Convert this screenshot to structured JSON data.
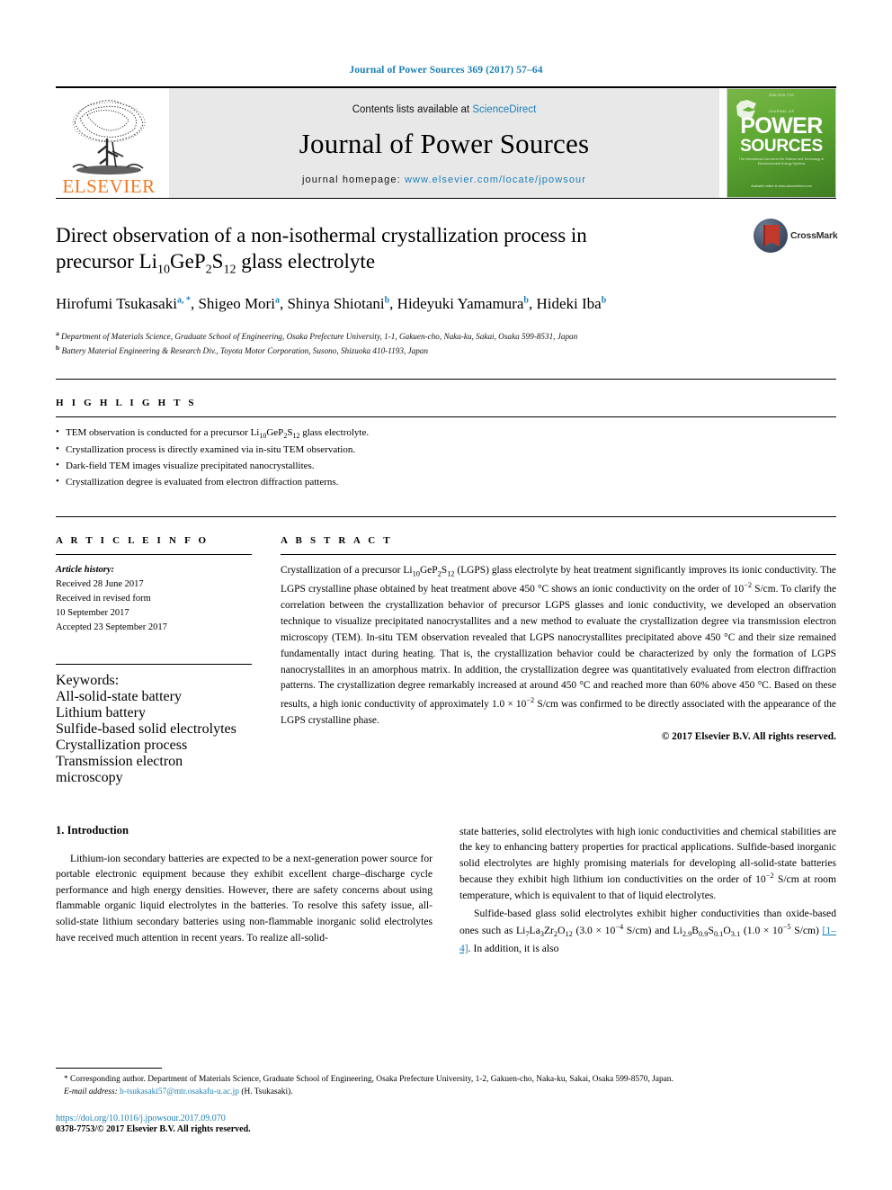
{
  "running_head": "Journal of Power Sources 369 (2017) 57–64",
  "masthead": {
    "publisher_name": "ELSEVIER",
    "contents_prefix": "Contents lists available at ",
    "contents_link": "ScienceDirect",
    "journal_title": "Journal of Power Sources",
    "homepage_prefix": "journal homepage: ",
    "homepage_url": "www.elsevier.com/locate/jpowsour",
    "cover": {
      "top_line": "ISSN 0378-7753",
      "journal_small": "JOURNAL OF",
      "word_power": "POWER",
      "word_sources": "SOURCES",
      "subtitle": "The International Journal on the Science and Technology of Electrochemical Energy Systems",
      "bottom": "Available online at www.sciencedirect.com"
    }
  },
  "article": {
    "title_line1": "Direct observation of a non-isothermal crystallization process in",
    "title_line2_pre": "precursor Li",
    "title_sub1": "10",
    "title_mid1": "GeP",
    "title_sub2": "2",
    "title_mid2": "S",
    "title_sub3": "12",
    "title_end": " glass electrolyte",
    "authors": [
      {
        "name": "Hirofumi Tsukasaki",
        "marks": "a, *"
      },
      {
        "name": "Shigeo Mori",
        "marks": "a"
      },
      {
        "name": "Shinya Shiotani",
        "marks": "b"
      },
      {
        "name": "Hideyuki Yamamura",
        "marks": "b"
      },
      {
        "name": "Hideki Iba",
        "marks": "b"
      }
    ],
    "affiliations": [
      {
        "mark": "a",
        "text": "Department of Materials Science, Graduate School of Engineering, Osaka Prefecture University, 1-1, Gakuen-cho, Naka-ku, Sakai, Osaka 599-8531, Japan"
      },
      {
        "mark": "b",
        "text": "Battery Material Engineering & Research Div., Toyota Motor Corporation, Susono, Shizuoka 410-1193, Japan"
      }
    ],
    "crossmark_label": "CrossMark"
  },
  "highlights": {
    "label": "H I G H L I G H T S",
    "items": [
      "TEM observation is conducted for a precursor Li10GeP2S12 glass electrolyte.",
      "Crystallization process is directly examined via in-situ TEM observation.",
      "Dark-field TEM images visualize precipitated nanocrystallites.",
      "Crystallization degree is evaluated from electron diffraction patterns."
    ]
  },
  "article_info": {
    "label": "A R T I C L E   I N F O",
    "history_label": "Article history:",
    "history": [
      "Received 28 June 2017",
      "Received in revised form",
      "10 September 2017",
      "Accepted 23 September 2017"
    ],
    "keywords_label": "Keywords:",
    "keywords": [
      "All-solid-state battery",
      "Lithium battery",
      "Sulfide-based solid electrolytes",
      "Crystallization process",
      "Transmission electron microscopy"
    ]
  },
  "abstract": {
    "label": "A B S T R A C T",
    "text_part1": "Crystallization of a precursor Li",
    "sub1": "10",
    "text_part2": "GeP",
    "sub2": "2",
    "text_part3": "S",
    "sub3": "12",
    "text_part4": " (LGPS) glass electrolyte by heat treatment significantly improves its ionic conductivity. The LGPS crystalline phase obtained by heat treatment above 450 °C shows an ionic conductivity on the order of 10",
    "sup1": "−2",
    "text_part5": " S/cm. To clarify the correlation between the crystallization behavior of precursor LGPS glasses and ionic conductivity, we developed an observation technique to visualize precipitated nanocrystallites and a new method to evaluate the crystallization degree via transmission electron microscopy (TEM). In-situ TEM observation revealed that LGPS nanocrystallites precipitated above 450 °C and their size remained fundamentally intact during heating. That is, the crystallization behavior could be characterized by only the formation of LGPS nanocrystallites in an amorphous matrix. In addition, the crystallization degree was quantitatively evaluated from electron diffraction patterns. The crystallization degree remarkably increased at around 450 °C and reached more than 60% above 450 °C. Based on these results, a high ionic conductivity of approximately 1.0 × 10",
    "sup2": "−2",
    "text_part6": " S/cm was confirmed to be directly associated with the appearance of the LGPS crystalline phase.",
    "copyright": "© 2017 Elsevier B.V. All rights reserved."
  },
  "body": {
    "section_heading": "1. Introduction",
    "col_left_p1": "Lithium-ion secondary batteries are expected to be a next-generation power source for portable electronic equipment because they exhibit excellent charge–discharge cycle performance and high energy densities. However, there are safety concerns about using flammable organic liquid electrolytes in the batteries. To resolve this safety issue, all-solid-state lithium secondary batteries using non-flammable inorganic solid electrolytes have received much attention in recent years. To realize all-solid-",
    "col_right_p1_a": "state batteries, solid electrolytes with high ionic conductivities and chemical stabilities are the key to enhancing battery properties for practical applications. Sulfide-based inorganic solid electrolytes are highly promising materials for developing all-solid-state batteries because they exhibit high lithium ion conductivities on the order of 10",
    "col_right_p1_sup": "−2",
    "col_right_p1_b": " S/cm at room temperature, which is equivalent to that of liquid electrolytes.",
    "col_right_p2_a": "Sulfide-based glass solid electrolytes exhibit higher conductivities than oxide-based ones such as Li",
    "col_right_p2_subs": [
      "7",
      "3",
      "2",
      "12"
    ],
    "col_right_p2_b": "La",
    "col_right_p2_c": "Zr",
    "col_right_p2_d": "O",
    "col_right_p2_e": " (3.0 × 10",
    "col_right_p2_sup1": "−4",
    "col_right_p2_f": " S/cm) and Li",
    "col_right_p2_g": "B",
    "col_right_p2_h": "S",
    "col_right_p2_i": "O",
    "col_right_p2_subs2": [
      "2.9",
      "0.9",
      "0.1",
      "3.1"
    ],
    "col_right_p2_j": " (1.0 × 10",
    "col_right_p2_sup2": "−5",
    "col_right_p2_k": " S/cm) ",
    "col_right_p2_ref": "[1–4]",
    "col_right_p2_l": ". In addition, it is also"
  },
  "footnotes": {
    "corresponding": "* Corresponding author. Department of Materials Science, Graduate School of Engineering, Osaka Prefecture University, 1-2, Gakuen-cho, Naka-ku, Sakai, Osaka 599-8570, Japan.",
    "email_label": "E-mail address:",
    "email": "h-tsukasaki57@mtr.osakafu-u.ac.jp",
    "email_suffix": " (H. Tsukasaki).",
    "doi": "https://doi.org/10.1016/j.jpowsour.2017.09.070",
    "issn": "0378-7753/© 2017 Elsevier B.V. All rights reserved."
  },
  "colors": {
    "link": "#1b7fb5",
    "elsevier_orange": "#f47920",
    "cover_green": "#5da832"
  }
}
